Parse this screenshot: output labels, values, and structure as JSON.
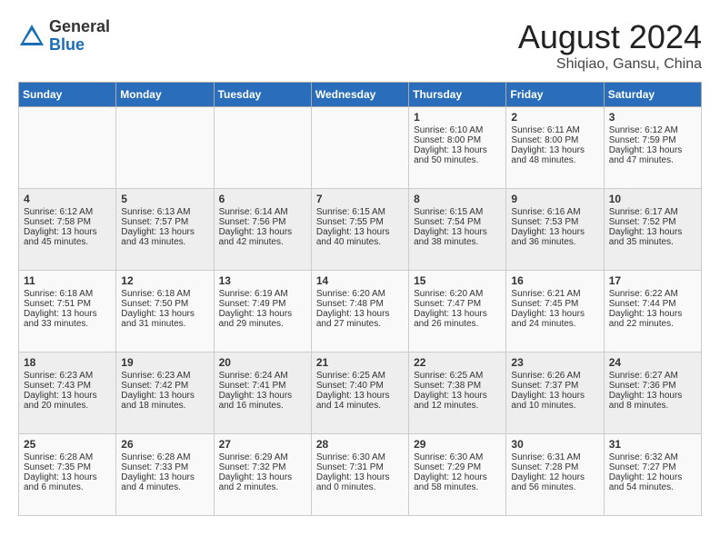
{
  "header": {
    "logo_general": "General",
    "logo_blue": "Blue",
    "month_year": "August 2024",
    "location": "Shiqiao, Gansu, China"
  },
  "days_of_week": [
    "Sunday",
    "Monday",
    "Tuesday",
    "Wednesday",
    "Thursday",
    "Friday",
    "Saturday"
  ],
  "weeks": [
    [
      {
        "day": "",
        "sunrise": "",
        "sunset": "",
        "daylight": ""
      },
      {
        "day": "",
        "sunrise": "",
        "sunset": "",
        "daylight": ""
      },
      {
        "day": "",
        "sunrise": "",
        "sunset": "",
        "daylight": ""
      },
      {
        "day": "",
        "sunrise": "",
        "sunset": "",
        "daylight": ""
      },
      {
        "day": "1",
        "sunrise": "Sunrise: 6:10 AM",
        "sunset": "Sunset: 8:00 PM",
        "daylight": "Daylight: 13 hours and 50 minutes."
      },
      {
        "day": "2",
        "sunrise": "Sunrise: 6:11 AM",
        "sunset": "Sunset: 8:00 PM",
        "daylight": "Daylight: 13 hours and 48 minutes."
      },
      {
        "day": "3",
        "sunrise": "Sunrise: 6:12 AM",
        "sunset": "Sunset: 7:59 PM",
        "daylight": "Daylight: 13 hours and 47 minutes."
      }
    ],
    [
      {
        "day": "4",
        "sunrise": "Sunrise: 6:12 AM",
        "sunset": "Sunset: 7:58 PM",
        "daylight": "Daylight: 13 hours and 45 minutes."
      },
      {
        "day": "5",
        "sunrise": "Sunrise: 6:13 AM",
        "sunset": "Sunset: 7:57 PM",
        "daylight": "Daylight: 13 hours and 43 minutes."
      },
      {
        "day": "6",
        "sunrise": "Sunrise: 6:14 AM",
        "sunset": "Sunset: 7:56 PM",
        "daylight": "Daylight: 13 hours and 42 minutes."
      },
      {
        "day": "7",
        "sunrise": "Sunrise: 6:15 AM",
        "sunset": "Sunset: 7:55 PM",
        "daylight": "Daylight: 13 hours and 40 minutes."
      },
      {
        "day": "8",
        "sunrise": "Sunrise: 6:15 AM",
        "sunset": "Sunset: 7:54 PM",
        "daylight": "Daylight: 13 hours and 38 minutes."
      },
      {
        "day": "9",
        "sunrise": "Sunrise: 6:16 AM",
        "sunset": "Sunset: 7:53 PM",
        "daylight": "Daylight: 13 hours and 36 minutes."
      },
      {
        "day": "10",
        "sunrise": "Sunrise: 6:17 AM",
        "sunset": "Sunset: 7:52 PM",
        "daylight": "Daylight: 13 hours and 35 minutes."
      }
    ],
    [
      {
        "day": "11",
        "sunrise": "Sunrise: 6:18 AM",
        "sunset": "Sunset: 7:51 PM",
        "daylight": "Daylight: 13 hours and 33 minutes."
      },
      {
        "day": "12",
        "sunrise": "Sunrise: 6:18 AM",
        "sunset": "Sunset: 7:50 PM",
        "daylight": "Daylight: 13 hours and 31 minutes."
      },
      {
        "day": "13",
        "sunrise": "Sunrise: 6:19 AM",
        "sunset": "Sunset: 7:49 PM",
        "daylight": "Daylight: 13 hours and 29 minutes."
      },
      {
        "day": "14",
        "sunrise": "Sunrise: 6:20 AM",
        "sunset": "Sunset: 7:48 PM",
        "daylight": "Daylight: 13 hours and 27 minutes."
      },
      {
        "day": "15",
        "sunrise": "Sunrise: 6:20 AM",
        "sunset": "Sunset: 7:47 PM",
        "daylight": "Daylight: 13 hours and 26 minutes."
      },
      {
        "day": "16",
        "sunrise": "Sunrise: 6:21 AM",
        "sunset": "Sunset: 7:45 PM",
        "daylight": "Daylight: 13 hours and 24 minutes."
      },
      {
        "day": "17",
        "sunrise": "Sunrise: 6:22 AM",
        "sunset": "Sunset: 7:44 PM",
        "daylight": "Daylight: 13 hours and 22 minutes."
      }
    ],
    [
      {
        "day": "18",
        "sunrise": "Sunrise: 6:23 AM",
        "sunset": "Sunset: 7:43 PM",
        "daylight": "Daylight: 13 hours and 20 minutes."
      },
      {
        "day": "19",
        "sunrise": "Sunrise: 6:23 AM",
        "sunset": "Sunset: 7:42 PM",
        "daylight": "Daylight: 13 hours and 18 minutes."
      },
      {
        "day": "20",
        "sunrise": "Sunrise: 6:24 AM",
        "sunset": "Sunset: 7:41 PM",
        "daylight": "Daylight: 13 hours and 16 minutes."
      },
      {
        "day": "21",
        "sunrise": "Sunrise: 6:25 AM",
        "sunset": "Sunset: 7:40 PM",
        "daylight": "Daylight: 13 hours and 14 minutes."
      },
      {
        "day": "22",
        "sunrise": "Sunrise: 6:25 AM",
        "sunset": "Sunset: 7:38 PM",
        "daylight": "Daylight: 13 hours and 12 minutes."
      },
      {
        "day": "23",
        "sunrise": "Sunrise: 6:26 AM",
        "sunset": "Sunset: 7:37 PM",
        "daylight": "Daylight: 13 hours and 10 minutes."
      },
      {
        "day": "24",
        "sunrise": "Sunrise: 6:27 AM",
        "sunset": "Sunset: 7:36 PM",
        "daylight": "Daylight: 13 hours and 8 minutes."
      }
    ],
    [
      {
        "day": "25",
        "sunrise": "Sunrise: 6:28 AM",
        "sunset": "Sunset: 7:35 PM",
        "daylight": "Daylight: 13 hours and 6 minutes."
      },
      {
        "day": "26",
        "sunrise": "Sunrise: 6:28 AM",
        "sunset": "Sunset: 7:33 PM",
        "daylight": "Daylight: 13 hours and 4 minutes."
      },
      {
        "day": "27",
        "sunrise": "Sunrise: 6:29 AM",
        "sunset": "Sunset: 7:32 PM",
        "daylight": "Daylight: 13 hours and 2 minutes."
      },
      {
        "day": "28",
        "sunrise": "Sunrise: 6:30 AM",
        "sunset": "Sunset: 7:31 PM",
        "daylight": "Daylight: 13 hours and 0 minutes."
      },
      {
        "day": "29",
        "sunrise": "Sunrise: 6:30 AM",
        "sunset": "Sunset: 7:29 PM",
        "daylight": "Daylight: 12 hours and 58 minutes."
      },
      {
        "day": "30",
        "sunrise": "Sunrise: 6:31 AM",
        "sunset": "Sunset: 7:28 PM",
        "daylight": "Daylight: 12 hours and 56 minutes."
      },
      {
        "day": "31",
        "sunrise": "Sunrise: 6:32 AM",
        "sunset": "Sunset: 7:27 PM",
        "daylight": "Daylight: 12 hours and 54 minutes."
      }
    ]
  ]
}
